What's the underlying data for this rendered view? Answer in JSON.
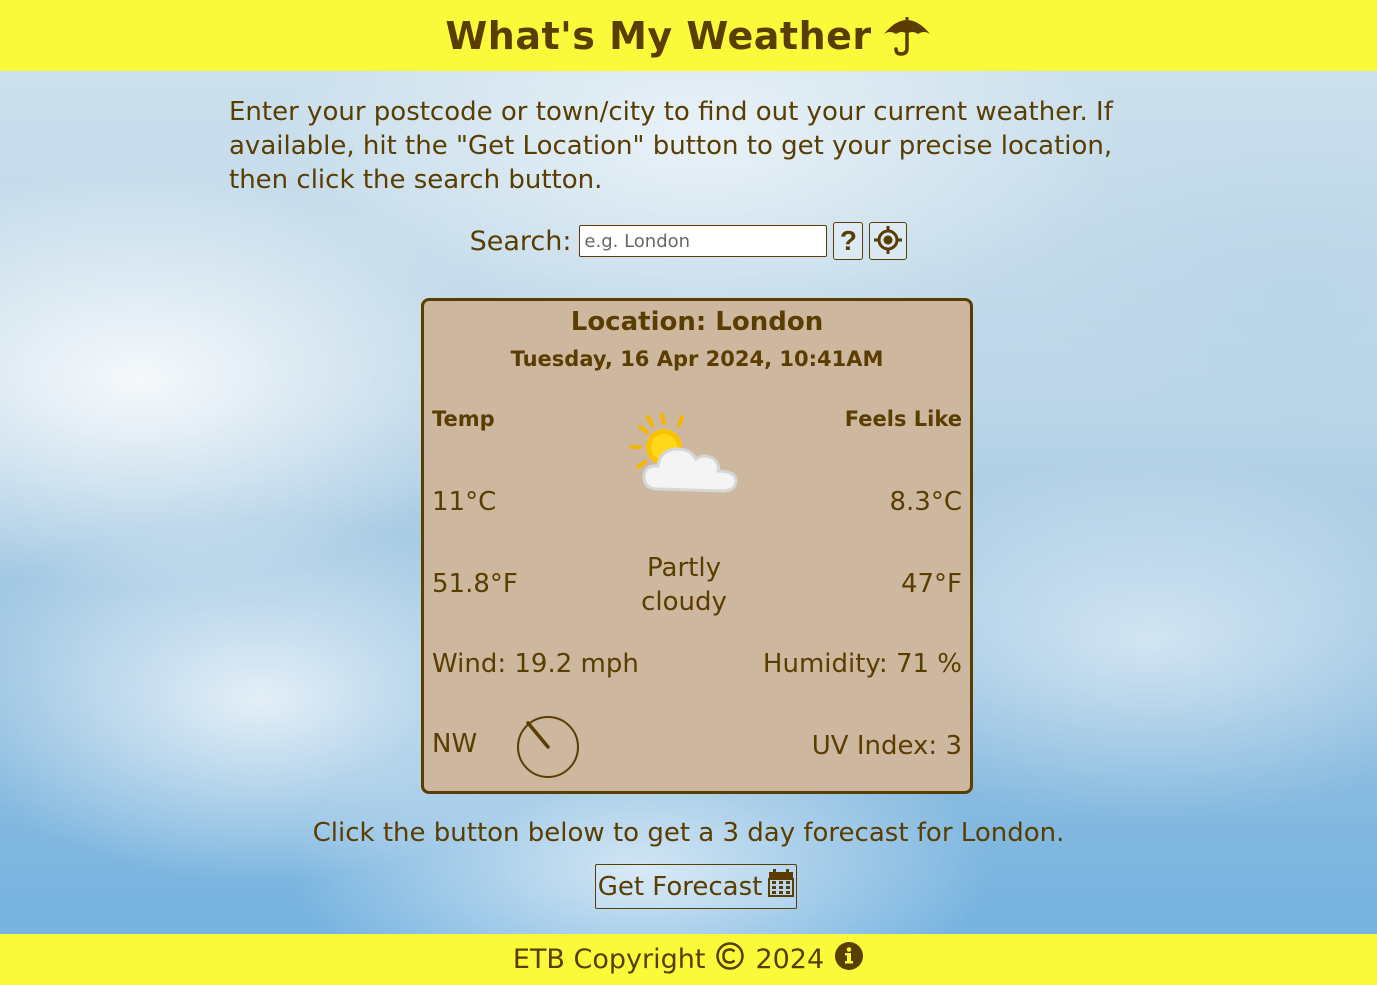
{
  "header": {
    "title": "What's My Weather",
    "icon": "umbrella-icon"
  },
  "intro": "Enter your postcode or town/city to find out your current weather. If available, hit the \"Get Location\" button to get your precise location, then click the search button.",
  "search": {
    "label": "Search:",
    "placeholder": "e.g. London",
    "value": "",
    "help_label": "?",
    "location_icon": "crosshair-location-icon"
  },
  "card": {
    "location": "Location: London",
    "datetime": "Tuesday, 16 Apr 2024, 10:41AM",
    "temp_label": "Temp",
    "feels_label": "Feels Like",
    "temp_c": "11°C",
    "feels_c": "8.3°C",
    "temp_f": "51.8°F",
    "feels_f": "47°F",
    "condition": "Partly cloudy",
    "condition_icon": "partly-cloudy-icon",
    "wind": "Wind: 19.2 mph",
    "humidity": "Humidity: 71 %",
    "wind_dir": "NW",
    "uv": "UV Index: 3"
  },
  "forecast": {
    "text": "Click the button below to get a 3 day forecast for London.",
    "button_label": "Get Forecast",
    "button_icon": "calendar-icon"
  },
  "footer": {
    "copyright": "ETB Copyright",
    "year": "2024",
    "copyright_icon": "copyright-icon",
    "info_icon": "info-icon"
  },
  "colors": {
    "accent_yellow": "#fafa3a",
    "text_brown": "#5a3d00",
    "card_tan": "#cdb79e"
  }
}
